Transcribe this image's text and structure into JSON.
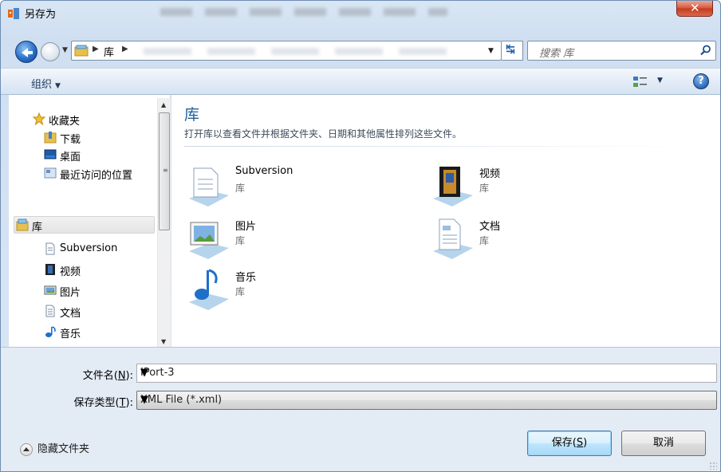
{
  "window": {
    "title": "另存为"
  },
  "nav": {
    "breadcrumb_library": "库",
    "search_placeholder": "搜索 库"
  },
  "toolbar": {
    "organize_label": "组织",
    "help_label": "?"
  },
  "sidebar": {
    "favorites": [
      {
        "label": "收藏夹",
        "icon": "star-icon"
      },
      {
        "label": "下载",
        "icon": "download-folder-icon"
      },
      {
        "label": "桌面",
        "icon": "desktop-icon"
      },
      {
        "label": "最近访问的位置",
        "icon": "recent-places-icon"
      }
    ],
    "libraries": [
      {
        "label": "库",
        "icon": "library-icon"
      },
      {
        "label": "Subversion",
        "icon": "document-icon"
      },
      {
        "label": "视频",
        "icon": "video-icon"
      },
      {
        "label": "图片",
        "icon": "picture-icon"
      },
      {
        "label": "文档",
        "icon": "document-icon"
      },
      {
        "label": "音乐",
        "icon": "music-icon"
      }
    ]
  },
  "content": {
    "title": "库",
    "description": "打开库以查看文件并根据文件夹、日期和其他属性排列这些文件。",
    "libraries": [
      {
        "name": "Subversion",
        "type": "库",
        "icon": "subversion-library-icon"
      },
      {
        "name": "视频",
        "type": "库",
        "icon": "video-library-icon"
      },
      {
        "name": "图片",
        "type": "库",
        "icon": "picture-library-icon"
      },
      {
        "name": "文档",
        "type": "库",
        "icon": "document-library-icon"
      },
      {
        "name": "音乐",
        "type": "库",
        "icon": "music-library-icon"
      }
    ]
  },
  "form": {
    "filename_label_pre": "文件名(",
    "filename_label_key": "N",
    "filename_label_post": "):",
    "filename_value": "IPort-3",
    "filetype_label_pre": "保存类型(",
    "filetype_label_key": "T",
    "filetype_label_post": "):",
    "filetype_value": "XML File (*.xml)"
  },
  "footer": {
    "hide_folders_label": "隐藏文件夹",
    "save_label_pre": "保存(",
    "save_label_key": "S",
    "save_label_post": ")",
    "cancel_label": "取消"
  },
  "colors": {
    "accent": "#1e5f97",
    "close_button": "#c43a1f",
    "primary_button": "#bee6fd"
  }
}
